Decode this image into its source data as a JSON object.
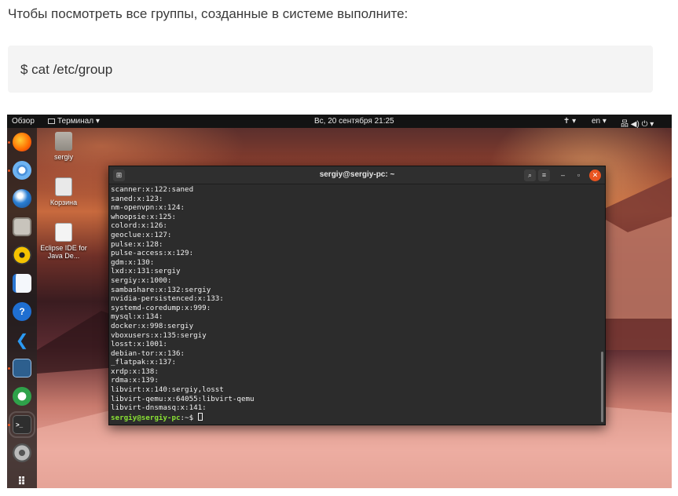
{
  "article": {
    "intro": "Чтобы посмотреть все группы, созданные в системе выполните:",
    "command": "$  cat /etc/group"
  },
  "topbar": {
    "overview": "Обзор",
    "app_menu": "Терминал ▾",
    "clock": "Вс, 20 сентября  21:25",
    "accessibility": "✝ ▾",
    "language": "en ▾",
    "system": "品 ◀) ⏻ ▾"
  },
  "desktop_icons": [
    {
      "label": "sergiy"
    },
    {
      "label": "Корзина"
    },
    {
      "label": "Eclipse IDE for Java De..."
    }
  ],
  "dock_apps": [
    "Firefox",
    "Chromium",
    "Thunderbird",
    "Files",
    "Rhythmbox",
    "LibreOffice Writer",
    "Help",
    "VS Code",
    "System Monitor",
    "Ubuntu Software",
    "Terminal",
    "Settings",
    "Show Applications"
  ],
  "terminal": {
    "title": "sergiy@sergiy-pc: ~",
    "lines": [
      "scanner:x:122:saned",
      "saned:x:123:",
      "nm-openvpn:x:124:",
      "whoopsie:x:125:",
      "colord:x:126:",
      "geoclue:x:127:",
      "pulse:x:128:",
      "pulse-access:x:129:",
      "gdm:x:130:",
      "lxd:x:131:sergiy",
      "sergiy:x:1000:",
      "sambashare:x:132:sergiy",
      "nvidia-persistenced:x:133:",
      "systemd-coredump:x:999:",
      "mysql:x:134:",
      "docker:x:998:sergiy",
      "vboxusers:x:135:sergiy",
      "losst:x:1001:",
      "debian-tor:x:136:",
      "_flatpak:x:137:",
      "xrdp:x:138:",
      "rdma:x:139:",
      "libvirt:x:140:sergiy,losst",
      "libvirt-qemu:x:64055:libvirt-qemu",
      "libvirt-dnsmasq:x:141:"
    ],
    "prompt_user": "sergiy@sergiy-pc",
    "prompt_rest": ":~$ "
  },
  "colors": {
    "accent": "#e95420",
    "prompt": "#8ae234",
    "terminal_bg": "#2c2c2c"
  }
}
